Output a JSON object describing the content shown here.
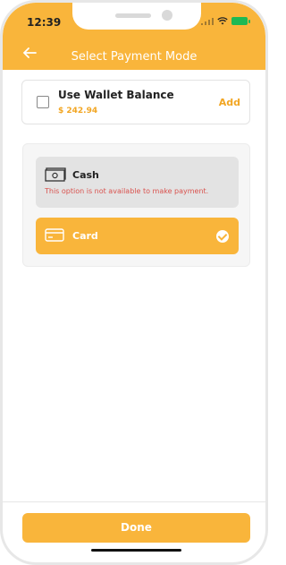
{
  "status_bar": {
    "time": "12:39"
  },
  "header": {
    "title": "Select Payment Mode"
  },
  "wallet": {
    "label": "Use Wallet Balance",
    "amount": "$ 242.94",
    "add_label": "Add"
  },
  "options": {
    "cash": {
      "label": "Cash",
      "warning": "This option is not available to make payment."
    },
    "card": {
      "label": "Card"
    }
  },
  "footer": {
    "done_label": "Done"
  },
  "colors": {
    "accent": "#f9b53b",
    "warning": "#d9534f"
  },
  "icons": [
    "back-arrow-icon",
    "cash-icon",
    "card-icon",
    "checkmark-icon",
    "battery-icon",
    "wifi-icon",
    "signal-icon",
    "location-arrow-icon"
  ]
}
